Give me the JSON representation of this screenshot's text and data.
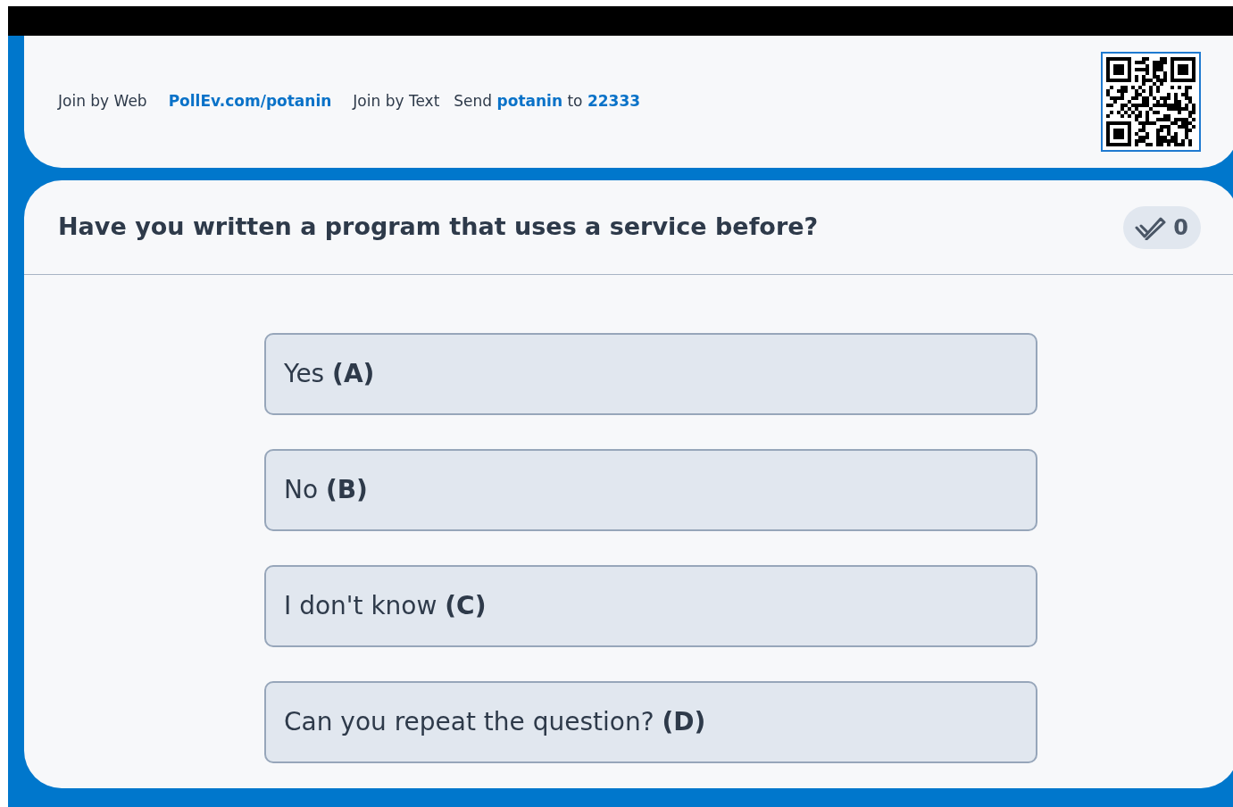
{
  "join_bar": {
    "web_label": "Join by Web",
    "web_link": "PollEv.com/potanin",
    "text_label": "Join by Text",
    "text_instruction": "Send **potanin** to **22333**"
  },
  "question": {
    "title": "Have you written a program that uses a service before?",
    "response_count": "0"
  },
  "options": [
    {
      "label": "Yes **(A)**"
    },
    {
      "label": "No **(B)**"
    },
    {
      "label": "I don't know **(C)**"
    },
    {
      "label": "Can you repeat the question? **(D)**"
    }
  ]
}
